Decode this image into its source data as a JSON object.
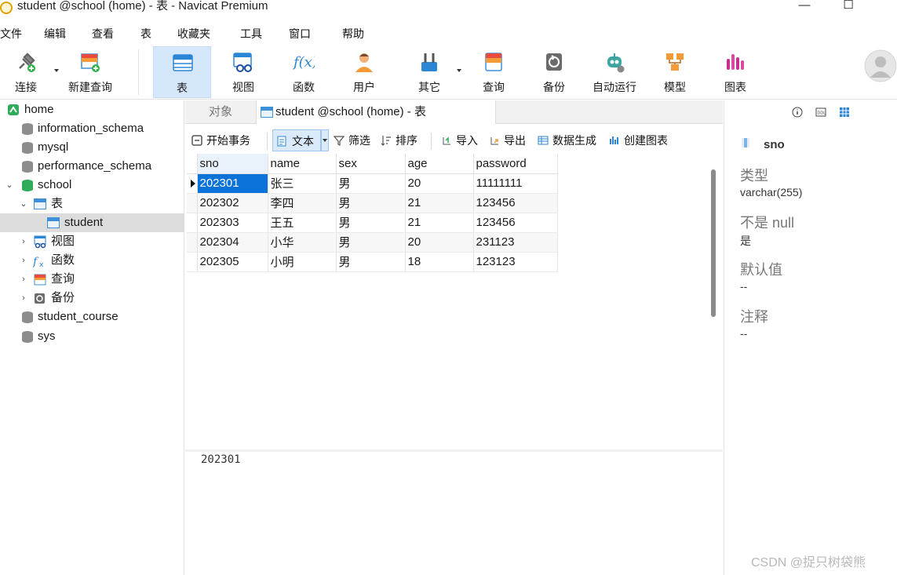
{
  "window": {
    "title": "student @school (home) - 表 - Navicat Premium",
    "maximize_glyph": "☐",
    "minimize_glyph": "—"
  },
  "menu": [
    "文件",
    "编辑",
    "查看",
    "表",
    "收藏夹",
    "工具",
    "窗口",
    "帮助"
  ],
  "toolbar": {
    "connect": "连接",
    "new_query": "新建查询",
    "table": "表",
    "view": "视图",
    "function": "函数",
    "user": "用户",
    "other": "其它",
    "query": "查询",
    "backup": "备份",
    "auto_run": "自动运行",
    "model": "模型",
    "chart": "图表"
  },
  "tree": {
    "connection": "home",
    "databases": [
      "information_schema",
      "mysql",
      "performance_schema",
      "school",
      "student_course",
      "sys"
    ],
    "school_children": {
      "tables": "表",
      "table_items": [
        "student"
      ],
      "views": "视图",
      "functions": "函数",
      "queries": "查询",
      "backups": "备份"
    }
  },
  "tabs": {
    "objects": "对象",
    "active": "student @school (home) - 表"
  },
  "subtoolbar": {
    "begin_transaction": "开始事务",
    "text": "文本",
    "filter": "筛选",
    "sort": "排序",
    "import": "导入",
    "export": "导出",
    "data_generation": "数据生成",
    "create_chart": "创建图表"
  },
  "table": {
    "columns": [
      "sno",
      "name",
      "sex",
      "age",
      "password"
    ],
    "rows": [
      [
        "202301",
        "张三",
        "男",
        "20",
        "11111111"
      ],
      [
        "202302",
        "李四",
        "男",
        "21",
        "123456"
      ],
      [
        "202303",
        "王五",
        "男",
        "21",
        "123456"
      ],
      [
        "202304",
        "小华",
        "男",
        "20",
        "231123"
      ],
      [
        "202305",
        "小明",
        "男",
        "18",
        "123123"
      ]
    ]
  },
  "preview_value": "202301",
  "field_info": {
    "name": "sno",
    "type_label": "类型",
    "type_value": "varchar(255)",
    "not_null_label": "不是 null",
    "not_null_value": "是",
    "default_label": "默认值",
    "default_value": "--",
    "comment_label": "注释",
    "comment_value": "--"
  },
  "watermark": "CSDN @捉只树袋熊",
  "colors": {
    "selection": "#0a73d9",
    "active_tool": "#d4e7fb",
    "school_db": "#2fab59"
  }
}
